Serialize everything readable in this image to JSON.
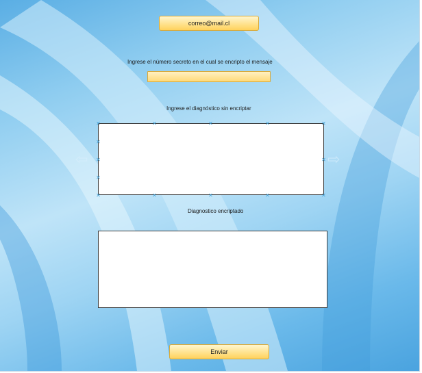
{
  "email_button": {
    "label": "correo@mail.cl"
  },
  "secret_number": {
    "label": "Ingrese el número secreto en el cual se encripto el mensaje",
    "value": ""
  },
  "diagnosis_plain": {
    "label": "Ingrese el diagnóstico sin encriptar",
    "value": ""
  },
  "diagnosis_encrypted": {
    "label": "Diagnostico encriptado",
    "value": ""
  },
  "send_button": {
    "label": "Enviar"
  },
  "icons": {
    "left_arrow": "arrow-left-icon",
    "right_arrow": "arrow-right-icon",
    "resize_handle": "resize-handle-icon"
  },
  "colors": {
    "button_fill": "#ffe69a",
    "button_border": "#d9aa3a",
    "background_blue": "#7cc3ee"
  }
}
